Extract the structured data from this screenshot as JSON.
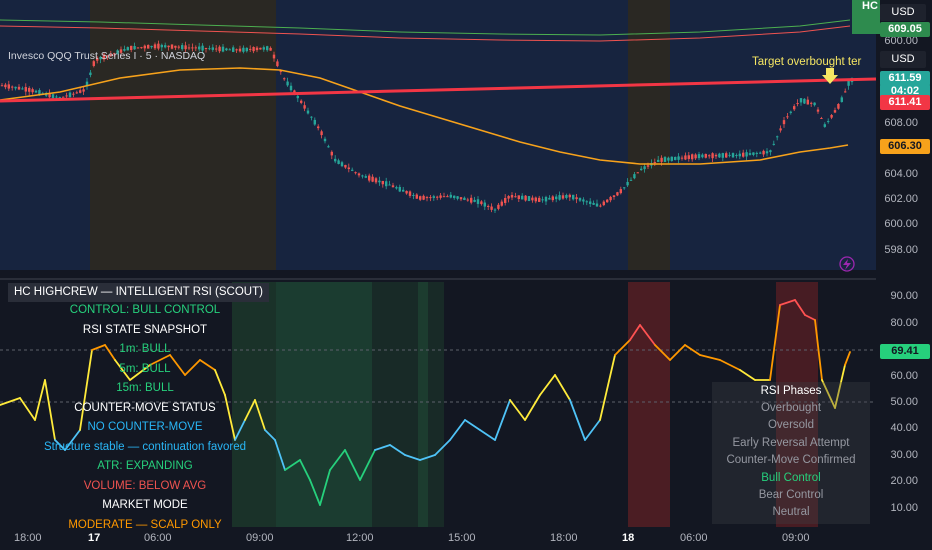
{
  "symbol_title": "Invesco QQQ Trust Series I · 5 · NASDAQ",
  "annotation": "Target overbought ter",
  "currency_labels": [
    "USD",
    "USD"
  ],
  "corner_badge": "HC",
  "price_axis": [
    "600.00",
    "608.00",
    "604.00",
    "602.00",
    "600.00",
    "598.00"
  ],
  "price_tags": {
    "top": "609.05",
    "last": "611.59",
    "countdown": "04:02",
    "bid": "611.41",
    "ma": "606.30"
  },
  "rsi_axis": [
    "90.00",
    "80.00",
    "60.00",
    "50.00",
    "40.00",
    "30.00",
    "20.00",
    "10.00"
  ],
  "rsi_value": "69.41",
  "time_axis": [
    "18:00",
    "17",
    "06:00",
    "09:00",
    "12:00",
    "15:00",
    "18:00",
    "18",
    "06:00",
    "09:00"
  ],
  "indicator": {
    "title": "HC HIGHCREW — INTELLIGENT RSI (SCOUT)",
    "lines": [
      {
        "text": "CONTROL: BULL CONTROL",
        "color": "#26d07c"
      },
      {
        "text": "RSI STATE SNAPSHOT",
        "color": "#ffffff"
      },
      {
        "text": "1m: BULL",
        "color": "#26d07c"
      },
      {
        "text": "5m: BULL",
        "color": "#26d07c"
      },
      {
        "text": "15m: BULL",
        "color": "#26d07c"
      },
      {
        "text": "COUNTER-MOVE STATUS",
        "color": "#ffffff"
      },
      {
        "text": "NO COUNTER-MOVE",
        "color": "#29b6f6"
      },
      {
        "text": "Structure stable — continuation favored",
        "color": "#29b6f6"
      },
      {
        "text": "ATR: EXPANDING",
        "color": "#26d07c"
      },
      {
        "text": "VOLUME: BELOW AVG",
        "color": "#ef5350"
      },
      {
        "text": "MARKET MODE",
        "color": "#ffffff"
      },
      {
        "text": "MODERATE — SCALP ONLY",
        "color": "#ff9800"
      }
    ]
  },
  "rsi_phases": {
    "title": "RSI Phases",
    "items": [
      {
        "text": "Overbought",
        "color": "#9598a1"
      },
      {
        "text": "Oversold",
        "color": "#9598a1"
      },
      {
        "text": "Early Reversal Attempt",
        "color": "#9598a1"
      },
      {
        "text": "Counter-Move Confirmed",
        "color": "#9598a1"
      },
      {
        "text": "Bull Control",
        "color": "#26d07c"
      },
      {
        "text": "Bear Control",
        "color": "#9598a1"
      },
      {
        "text": "Neutral",
        "color": "#9598a1"
      }
    ]
  },
  "colors": {
    "background": "#131722",
    "bull": "#26a69a",
    "bear": "#ef5350",
    "resistance": "#f23645",
    "ma": "#f7a21b",
    "accent_green": "#26d07c"
  }
}
